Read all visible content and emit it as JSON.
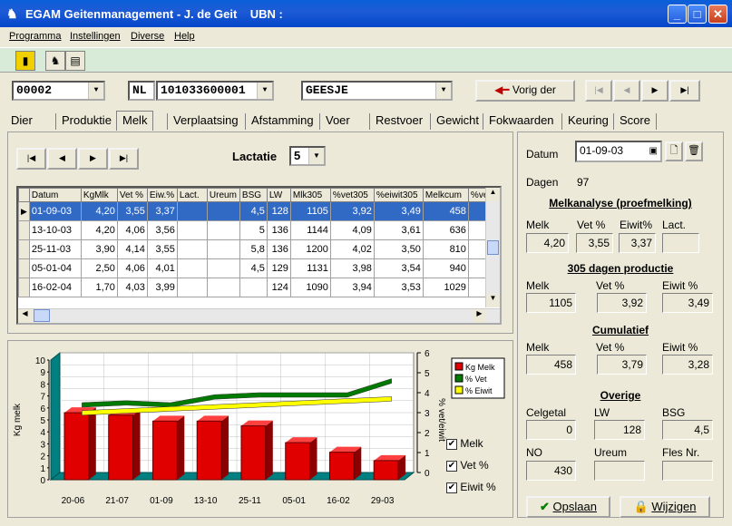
{
  "window": {
    "title": "EGAM Geitenmanagement - J. de Geit",
    "ubn_label": "UBN :"
  },
  "menu": [
    "Programma",
    "Instellingen",
    "Diverse",
    "Help"
  ],
  "selector": {
    "animal_no": "00002",
    "country": "NL",
    "life_no": "101033600001",
    "name": "GEESJE",
    "prev_label": "Vorig der"
  },
  "tabs": [
    "Dier",
    "Produktie",
    "Melk",
    "Verplaatsing",
    "Afstamming",
    "Voer",
    "Restvoer",
    "Gewicht",
    "Fokwaarden",
    "Keuring",
    "Score"
  ],
  "active_tab": "Melk",
  "lactatie": {
    "label": "Lactatie",
    "value": "5"
  },
  "grid": {
    "columns": [
      "Datum",
      "KgMlk",
      "Vet %",
      "Eiw.%",
      "Lact.",
      "Ureum",
      "BSG",
      "LW",
      "Mlk305",
      "%vet305",
      "%eiwit305",
      "Melkcum",
      "%ve"
    ],
    "rows": [
      [
        "01-09-03",
        "4,20",
        "3,55",
        "3,37",
        "",
        "",
        "4,5",
        "128",
        "1105",
        "3,92",
        "3,49",
        "458"
      ],
      [
        "13-10-03",
        "4,20",
        "4,06",
        "3,56",
        "",
        "",
        "5",
        "136",
        "1144",
        "4,09",
        "3,61",
        "636"
      ],
      [
        "25-11-03",
        "3,90",
        "4,14",
        "3,55",
        "",
        "",
        "5,8",
        "136",
        "1200",
        "4,02",
        "3,50",
        "810"
      ],
      [
        "05-01-04",
        "2,50",
        "4,06",
        "4,01",
        "",
        "",
        "4,5",
        "129",
        "1131",
        "3,98",
        "3,54",
        "940"
      ],
      [
        "16-02-04",
        "1,70",
        "4,03",
        "3,99",
        "",
        "",
        "",
        "124",
        "1090",
        "3,94",
        "3,53",
        "1029"
      ]
    ]
  },
  "chart_data": {
    "type": "bar",
    "categories": [
      "20-06",
      "21-07",
      "01-09",
      "13-10",
      "25-11",
      "05-01",
      "16-02",
      "29-03"
    ],
    "series": [
      {
        "name": "Kg Melk",
        "type": "bar",
        "axis": "left",
        "color": "#e00000",
        "values": [
          5.6,
          5.4,
          4.9,
          4.9,
          4.5,
          3.1,
          2.3,
          1.6
        ]
      },
      {
        "name": "% Vet",
        "type": "line",
        "axis": "right",
        "color": "#007a00",
        "values": [
          3.5,
          3.6,
          3.5,
          3.9,
          4.0,
          4.0,
          4.0,
          4.7
        ]
      },
      {
        "name": "% Eiwit",
        "type": "line",
        "axis": "right",
        "color": "#ffff00",
        "values": [
          3.1,
          3.2,
          3.3,
          3.4,
          3.5,
          3.6,
          3.7,
          3.8
        ]
      }
    ],
    "ylabel": "Kg melk",
    "y2label": "% vet/eiwit",
    "ylim": [
      0,
      10
    ],
    "y2lim": [
      0,
      6
    ],
    "yticks": [
      "0",
      "1",
      "2",
      "3",
      "4",
      "5",
      "6",
      "7",
      "8",
      "9",
      "10"
    ],
    "y2ticks": [
      "0",
      "1",
      "2",
      "3",
      "4",
      "5",
      "6"
    ],
    "legend": [
      "Kg Melk",
      "% Vet",
      "% Eiwit"
    ]
  },
  "checks": [
    {
      "label": "Melk",
      "checked": true
    },
    {
      "label": "Vet %",
      "checked": true
    },
    {
      "label": "Eiwit %",
      "checked": true
    }
  ],
  "right": {
    "datum_label": "Datum",
    "datum": "01-09-03",
    "dagen_label": "Dagen",
    "dagen": "97",
    "melkanalyse": {
      "title": "Melkanalyse (proefmelking)",
      "melk_l": "Melk",
      "melk": "4,20",
      "vet_l": "Vet %",
      "vet": "3,55",
      "eiwit_l": "Eiwit%",
      "eiwit": "3,37",
      "lact_l": "Lact.",
      "lact": ""
    },
    "p305": {
      "title": "305 dagen productie",
      "melk_l": "Melk",
      "melk": "1105",
      "vet_l": "Vet %",
      "vet": "3,92",
      "eiwit_l": "Eiwit %",
      "eiwit": "3,49"
    },
    "cum": {
      "title": "Cumulatief",
      "melk_l": "Melk",
      "melk": "458",
      "vet_l": "Vet %",
      "vet": "3,79",
      "eiwit_l": "Eiwit %",
      "eiwit": "3,28"
    },
    "overige": {
      "title": "Overige",
      "celgetal_l": "Celgetal",
      "celgetal": "0",
      "lw_l": "LW",
      "lw": "128",
      "bsg_l": "BSG",
      "bsg": "4,5",
      "no_l": "NO",
      "no": "430",
      "ureum_l": "Ureum",
      "ureum": "",
      "fles_l": "Fles Nr.",
      "fles": ""
    },
    "save_label": "Opslaan",
    "edit_label": "Wijzigen"
  }
}
